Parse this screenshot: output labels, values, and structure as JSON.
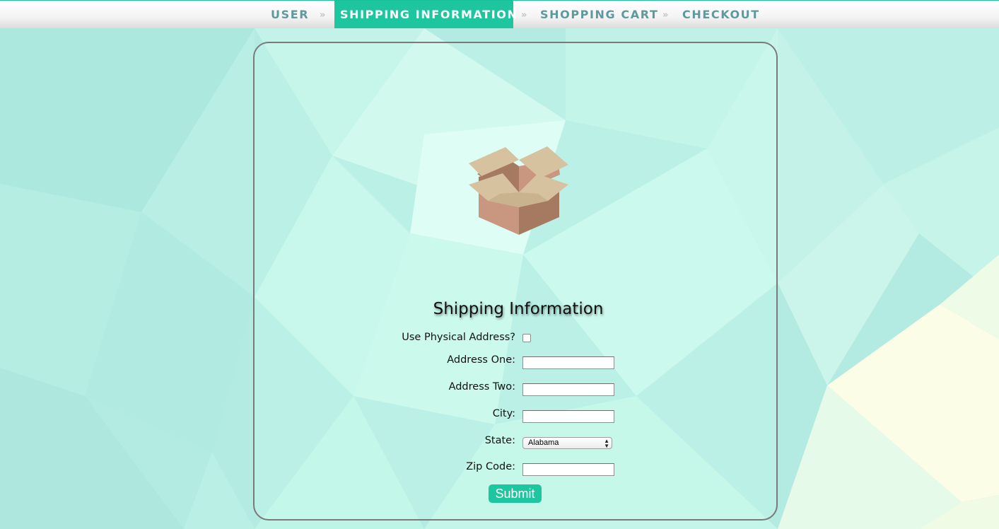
{
  "nav": {
    "items": [
      {
        "label": "USER",
        "active": false
      },
      {
        "label": "SHIPPING INFORMATION",
        "active": true
      },
      {
        "label": "SHOPPING CART",
        "active": false
      },
      {
        "label": "CHECKOUT",
        "active": false
      }
    ],
    "separator": "»",
    "separator_icon": "double-chevron-right-icon"
  },
  "card": {
    "icon": "open-box-icon",
    "title": "Shipping Information"
  },
  "form": {
    "physical_address_label": "Use Physical Address?",
    "physical_address_checked": false,
    "address_one_label": "Address One:",
    "address_one_value": "",
    "address_two_label": "Address Two:",
    "address_two_value": "",
    "city_label": "City:",
    "city_value": "",
    "state_label": "State:",
    "state_selected": "Alabama",
    "zip_label": "Zip Code:",
    "zip_value": "",
    "submit_label": "Submit"
  },
  "colors": {
    "accent": "#1ec6a0",
    "nav_text": "#5d9aa0",
    "background": "#b2ece2",
    "card_border": "#7a7a7a"
  }
}
